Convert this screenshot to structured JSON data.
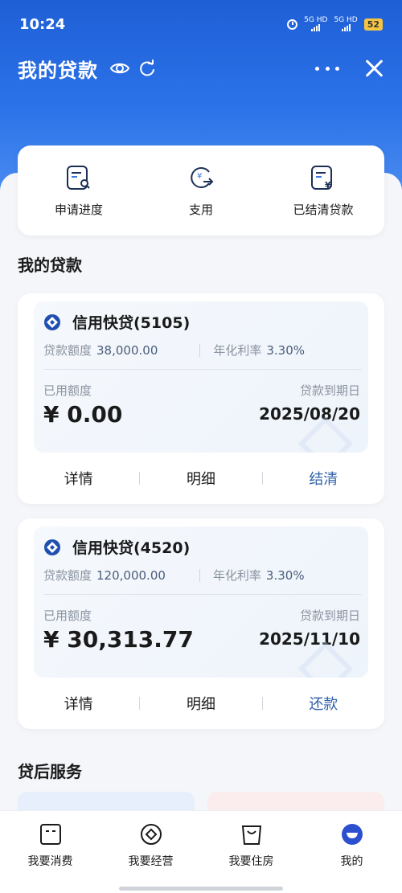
{
  "status": {
    "time": "10:24",
    "sim1": "5G HD",
    "sim2": "5G HD",
    "battery": "52"
  },
  "nav": {
    "title": "我的贷款"
  },
  "quick_actions": [
    {
      "label": "申请进度",
      "icon": "application-progress-icon"
    },
    {
      "label": "支用",
      "icon": "drawdown-icon"
    },
    {
      "label": "已结清贷款",
      "icon": "settled-loans-icon"
    }
  ],
  "section_loans": "我的贷款",
  "loans": [
    {
      "name": "信用快贷(5105)",
      "limit_label": "贷款额度",
      "limit_value": "38,000.00",
      "rate_label": "年化利率",
      "rate_value": "3.30%",
      "used_label": "已用额度",
      "used_amount": "¥ 0.00",
      "due_label": "贷款到期日",
      "due_date": "2025/08/20",
      "actions": [
        "详情",
        "明细",
        "结清"
      ]
    },
    {
      "name": "信用快贷(4520)",
      "limit_label": "贷款额度",
      "limit_value": "120,000.00",
      "rate_label": "年化利率",
      "rate_value": "3.30%",
      "used_label": "已用额度",
      "used_amount": "¥ 30,313.77",
      "due_label": "贷款到期日",
      "due_date": "2025/11/10",
      "actions": [
        "详情",
        "明细",
        "还款"
      ]
    }
  ],
  "section_services": "贷后服务",
  "tabs": [
    {
      "label": "我要消费",
      "icon": "consume-icon"
    },
    {
      "label": "我要经营",
      "icon": "business-icon"
    },
    {
      "label": "我要住房",
      "icon": "housing-icon"
    },
    {
      "label": "我的",
      "icon": "profile-icon",
      "active": true
    }
  ],
  "colors": {
    "brand_blue": "#1f5fd6",
    "action_blue": "#2f5fa8",
    "tab_active": "#2b4fcf"
  }
}
